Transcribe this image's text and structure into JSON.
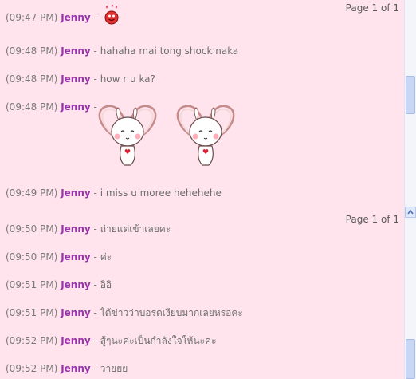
{
  "pane1": {
    "page_indicator": "Page 1 of 1",
    "messages": [
      {
        "time": "(09:47 PM)",
        "name": "Jenny",
        "sep": "-",
        "text": "",
        "emoticon": "red-smiley-hearts-icon"
      },
      {
        "time": "(09:48 PM)",
        "name": "Jenny",
        "sep": "-",
        "text": "hahaha mai tong shock naka"
      },
      {
        "time": "(09:48 PM)",
        "name": "Jenny",
        "sep": "-",
        "text": "how r u ka?"
      },
      {
        "time": "(09:48 PM)",
        "name": "Jenny",
        "sep": "-",
        "text": "",
        "emoticon": "bunny-heart-ears-icon"
      },
      {
        "time": "(09:49 PM)",
        "name": "Jenny",
        "sep": "-",
        "text": "i miss u moree hehehehe"
      }
    ],
    "scroll_level": 0.85
  },
  "pane2": {
    "page_indicator": "Page 1 of 1",
    "messages": [
      {
        "time": "(09:50 PM)",
        "name": "Jenny",
        "sep": "-",
        "text": "ถ่ายแต่เข้าเลยคะ"
      },
      {
        "time": "(09:50 PM)",
        "name": "Jenny",
        "sep": "-",
        "text": "ค่ะ"
      },
      {
        "time": "(09:51 PM)",
        "name": "Jenny",
        "sep": "-",
        "text": "อิอิ"
      },
      {
        "time": "(09:51 PM)",
        "name": "Jenny",
        "sep": "-",
        "text": "ได้ข่าวว่าบอรดเงียบมากเลยหรอคะ"
      },
      {
        "time": "(09:52 PM)",
        "name": "Jenny",
        "sep": "-",
        "text": "สู้ๆนะค่ะเป็นกำลังใจให้นะคะ"
      },
      {
        "time": "(09:52 PM)",
        "name": "Jenny",
        "sep": "-",
        "text": "วายยย"
      }
    ],
    "scroll_level": 1.0
  },
  "colors": {
    "background": "#ffe4ee",
    "name": "#9933aa",
    "text": "#6e6e6e"
  }
}
